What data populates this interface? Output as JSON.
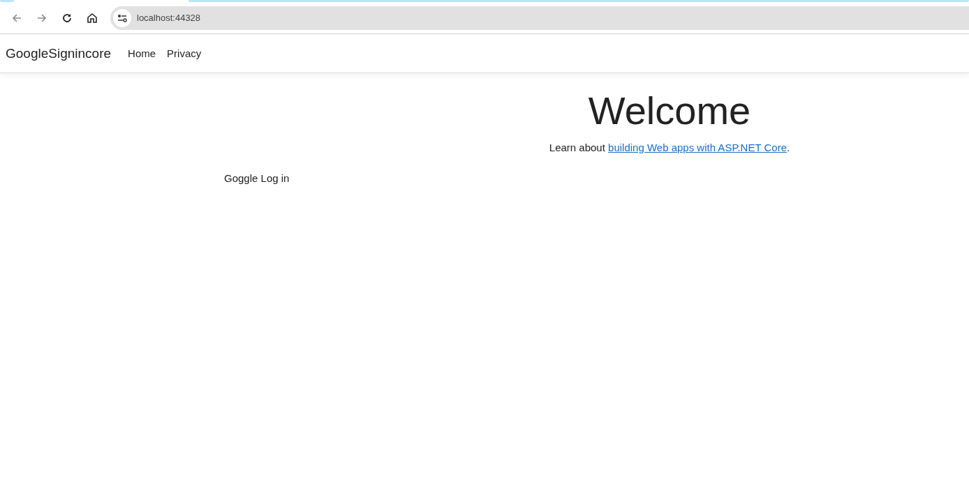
{
  "browser": {
    "address": "localhost:44328"
  },
  "navbar": {
    "brand": "GoogleSignincore",
    "links": [
      {
        "label": "Home"
      },
      {
        "label": "Privacy"
      }
    ]
  },
  "login_link": "Goggle Log in",
  "welcome": {
    "title": "Welcome",
    "text_before": "Learn about",
    "link": "building Web apps with ASP.NET Core",
    "text_after": "."
  }
}
